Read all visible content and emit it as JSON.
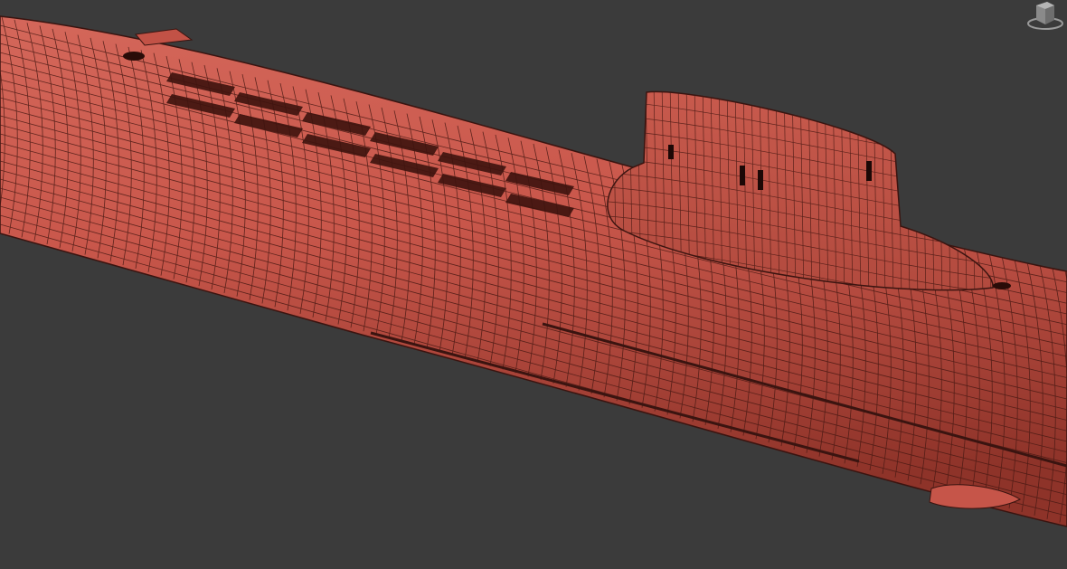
{
  "viewport": {
    "background": "#3b3b3b",
    "mode": "wireframe-on-shaded"
  },
  "model": {
    "name_icon": "submarine-model",
    "hull_color": "#c9574b",
    "edge_color": "#3a1410",
    "hatch_color": "#4a1812"
  },
  "viewcube": {
    "icon": "viewcube-icon"
  }
}
